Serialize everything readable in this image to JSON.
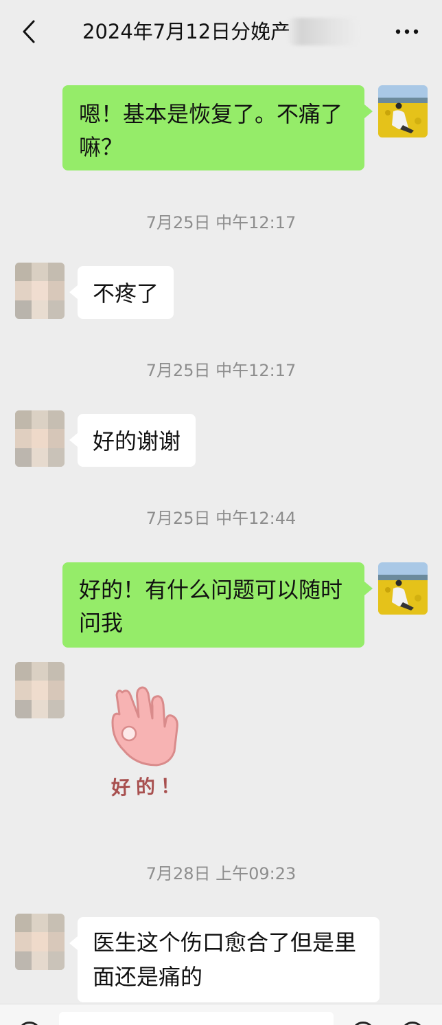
{
  "header": {
    "title": "2024年7月12日分娩产",
    "back_icon": "chevron-left-icon",
    "more_icon": "more-dots-icon"
  },
  "messages": [
    {
      "sender": "me",
      "text_line1": "嗯！基本是恢复了。不痛了",
      "text_line2": "嘛？"
    },
    {
      "type": "time",
      "text": "7月25日 中午12:17"
    },
    {
      "sender": "other",
      "text": "不疼了"
    },
    {
      "type": "time",
      "text": "7月25日 中午12:17"
    },
    {
      "sender": "other",
      "text": "好的谢谢"
    },
    {
      "type": "time",
      "text": "7月25日 中午12:44"
    },
    {
      "sender": "me",
      "text_line1": "好的！有什么问题可以随时",
      "text_line2": "问我"
    },
    {
      "sender": "other",
      "type": "sticker",
      "text": "好的！"
    },
    {
      "type": "time",
      "text": "7月28日 上午09:23"
    },
    {
      "sender": "other",
      "text_line1": "医生这个伤口愈合了但是里",
      "text_line2": "面还是痛的"
    }
  ],
  "colors": {
    "background": "#ededed",
    "my_bubble": "#95ec69",
    "other_bubble": "#ffffff",
    "timestamp": "#8d8d8d"
  }
}
